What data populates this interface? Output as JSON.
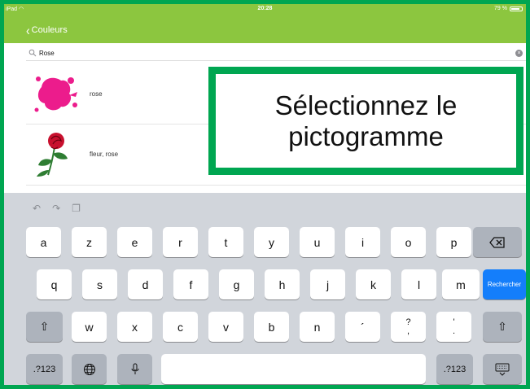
{
  "status_bar": {
    "device": "iPad",
    "time": "20:28",
    "battery": "79 %"
  },
  "nav": {
    "back_label": "Couleurs"
  },
  "search": {
    "value": "Rose"
  },
  "results": [
    {
      "label": "rose",
      "icon": "pink-paint-splash-icon"
    },
    {
      "label": "fleur, rose",
      "icon": "red-rose-flower-icon"
    }
  ],
  "callout": {
    "line1": "Sélectionnez le",
    "line2": "pictogramme"
  },
  "keyboard": {
    "row1": [
      "a",
      "z",
      "e",
      "r",
      "t",
      "y",
      "u",
      "i",
      "o",
      "p"
    ],
    "row2": [
      "q",
      "s",
      "d",
      "f",
      "g",
      "h",
      "j",
      "k",
      "l",
      "m"
    ],
    "row3": [
      "w",
      "x",
      "c",
      "v",
      "b",
      "n",
      "´",
      "?\n,",
      "'\n."
    ],
    "numbers_label": ".?123",
    "search_key_label": "Rechercher",
    "accent_color": "#147efb"
  },
  "colors": {
    "nav_bar": "#8cc63f",
    "highlight_border": "#00a651"
  }
}
